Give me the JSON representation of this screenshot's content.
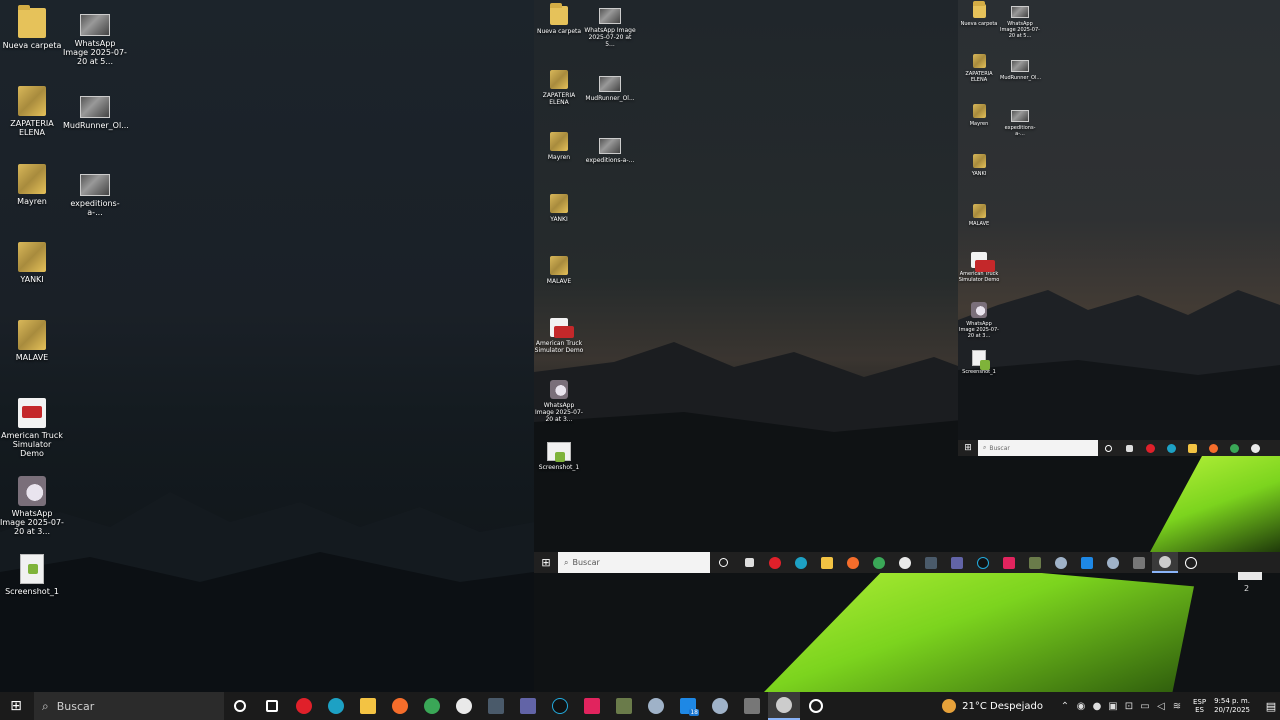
{
  "desktop": {
    "main_icons": [
      {
        "label": "Nueva carpeta",
        "kind": "folder"
      },
      {
        "label": "WhatsApp Image 2025-07-20 at 5...",
        "kind": "photo"
      },
      {
        "label": "ZAPATERIA ELENA",
        "kind": "folderimg"
      },
      {
        "label": "MudRunner_Ol...",
        "kind": "photo"
      },
      {
        "label": "Mayren",
        "kind": "folderimg"
      },
      {
        "label": "expeditions-a-...",
        "kind": "photo"
      },
      {
        "label": "YANKI",
        "kind": "folderimg"
      },
      {
        "label": "MALAVE",
        "kind": "folderimg"
      },
      {
        "label": "American Truck Simulator Demo",
        "kind": "truck"
      },
      {
        "label": "WhatsApp Image 2025-07-20 at 3...",
        "kind": "wa"
      },
      {
        "label": "Screenshot_1",
        "kind": "doc"
      }
    ],
    "mid_icons": [
      {
        "label": "Nueva carpeta"
      },
      {
        "label": "WhatsApp Image 2025-07-20 at 5..."
      },
      {
        "label": "ZAPATERIA ELENA"
      },
      {
        "label": "MudRunner_Ol..."
      },
      {
        "label": "Mayren"
      },
      {
        "label": "expeditions-a-..."
      },
      {
        "label": "YANKI"
      },
      {
        "label": "MALAVE"
      },
      {
        "label": "American Truck Simulator Demo"
      },
      {
        "label": "WhatsApp Image 2025-07-20 at 3..."
      },
      {
        "label": "Screenshot_1"
      }
    ],
    "right_icons": [
      {
        "label": "Nueva carpeta"
      },
      {
        "label": "WhatsApp Image 2025-07-20 at 5..."
      },
      {
        "label": "ZAPATERIA ELENA"
      },
      {
        "label": "MudRunner_Ol..."
      },
      {
        "label": "Mayren"
      },
      {
        "label": "expeditions-a-..."
      },
      {
        "label": "YANKI"
      },
      {
        "label": "MALAVE"
      },
      {
        "label": "American Truck Simulator Demo"
      },
      {
        "label": "WhatsApp Image 2025-07-20 at 3..."
      },
      {
        "label": "Screenshot_1"
      }
    ],
    "mid_counter": "2"
  },
  "taskbar": {
    "search_placeholder": "Buscar",
    "start_icon": "windows-logo-icon",
    "apps": [
      {
        "name": "cortana-icon",
        "color": "#ffffff"
      },
      {
        "name": "task-view-icon",
        "color": "#ffffff"
      },
      {
        "name": "opera-icon",
        "color": "#e0202a"
      },
      {
        "name": "edge-icon",
        "color": "#1da1c4"
      },
      {
        "name": "file-explorer-icon",
        "color": "#f3c343"
      },
      {
        "name": "firefox-icon",
        "color": "#f56d2b"
      },
      {
        "name": "chrome-icon",
        "color": "#3aa757"
      },
      {
        "name": "messenger-icon",
        "color": "#e9e9e9"
      },
      {
        "name": "app-window-icon",
        "color": "#4a5a6a"
      },
      {
        "name": "teams-icon",
        "color": "#6264a7"
      },
      {
        "name": "tiktok-icon",
        "color": "#111111"
      },
      {
        "name": "tiktok-pink-icon",
        "color": "#e1245e"
      },
      {
        "name": "game-app-icon",
        "color": "#6a7b4a"
      },
      {
        "name": "steam-icon",
        "color": "#9fb2c8"
      },
      {
        "name": "store-app-icon",
        "color": "#1e88e5"
      },
      {
        "name": "steam2-icon",
        "color": "#9fb2c8"
      },
      {
        "name": "truck-app-icon",
        "color": "#777777"
      },
      {
        "name": "obs-icon",
        "color": "#cccccc"
      },
      {
        "name": "media-player-icon",
        "color": "#ffffff"
      }
    ],
    "store_badge": "18",
    "weather": "21°C  Despejado",
    "lang": {
      "line1": "ESP",
      "line2": "ES"
    },
    "clock": {
      "time": "9:54 p. m.",
      "date": "20/7/2025"
    }
  }
}
